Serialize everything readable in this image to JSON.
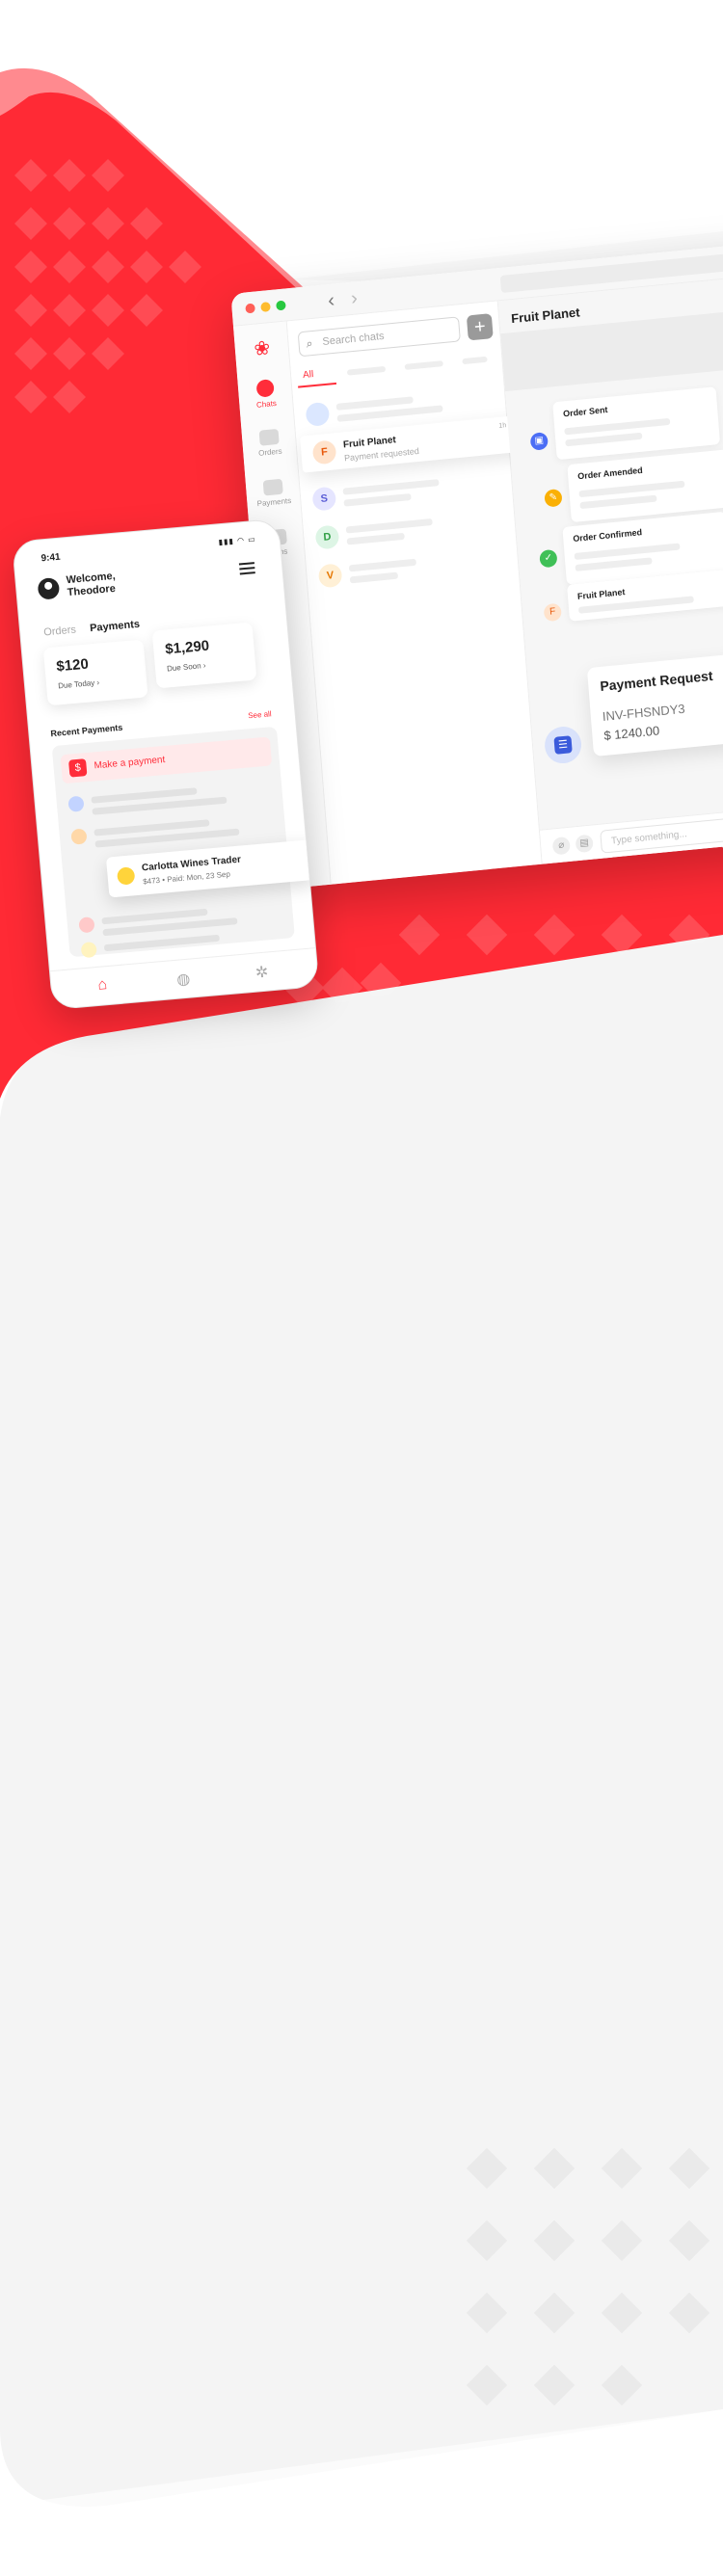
{
  "colors": {
    "brand_red": "#ff2d3a",
    "background_gray": "#f4f4f4"
  },
  "desktop": {
    "nav_back": "‹",
    "nav_forward": "›",
    "rail": {
      "logo": "❀",
      "items": [
        {
          "label": "Chats",
          "icon": "chat-icon"
        },
        {
          "label": "Orders",
          "icon": "orders-icon"
        },
        {
          "label": "Payments",
          "icon": "payments-icon"
        },
        {
          "label": "Items",
          "icon": "items-icon"
        }
      ],
      "bottom_icons": [
        "sort-icon",
        "gear-icon"
      ]
    },
    "chat_list": {
      "search_placeholder": "Search chats",
      "add_label": "+",
      "tab_all": "All",
      "selected": {
        "initial": "F",
        "name": "Fruit Planet",
        "subtitle": "Payment requested",
        "time": "1h ago"
      },
      "avatars": [
        "S",
        "D",
        "V"
      ]
    },
    "conversation": {
      "title": "Fruit Planet",
      "events": [
        "Order Sent",
        "Order Amended",
        "Order Confirmed"
      ],
      "sender": {
        "initial": "F",
        "name": "Fruit Planet"
      },
      "payment_request": {
        "title": "Payment Request",
        "invoice": "INV-FHSNDY3",
        "amount": "$ 1240.00"
      },
      "composer_placeholder": "Type something..."
    }
  },
  "phone": {
    "time": "9:41",
    "status": "▮▮▮ ◠ ▭",
    "welcome_line1": "Welcome,",
    "welcome_line2": "Theodore",
    "tabs": {
      "orders": "Orders",
      "payments": "Payments"
    },
    "due_today": {
      "amount": "$120",
      "label": "Due Today ›"
    },
    "due_soon": {
      "amount": "$1,290",
      "label": "Due Soon ›"
    },
    "recent_title": "Recent Payments",
    "see_all": "See all",
    "make_payment": {
      "icon": "$",
      "label": "Make a payment"
    },
    "highlight": {
      "name": "Carlotta Wines Trader",
      "detail": "$473 • Paid: Mon, 23 Sep"
    },
    "nav_icons": {
      "home": "⌂",
      "chat": "◍",
      "settings": "✲"
    }
  }
}
